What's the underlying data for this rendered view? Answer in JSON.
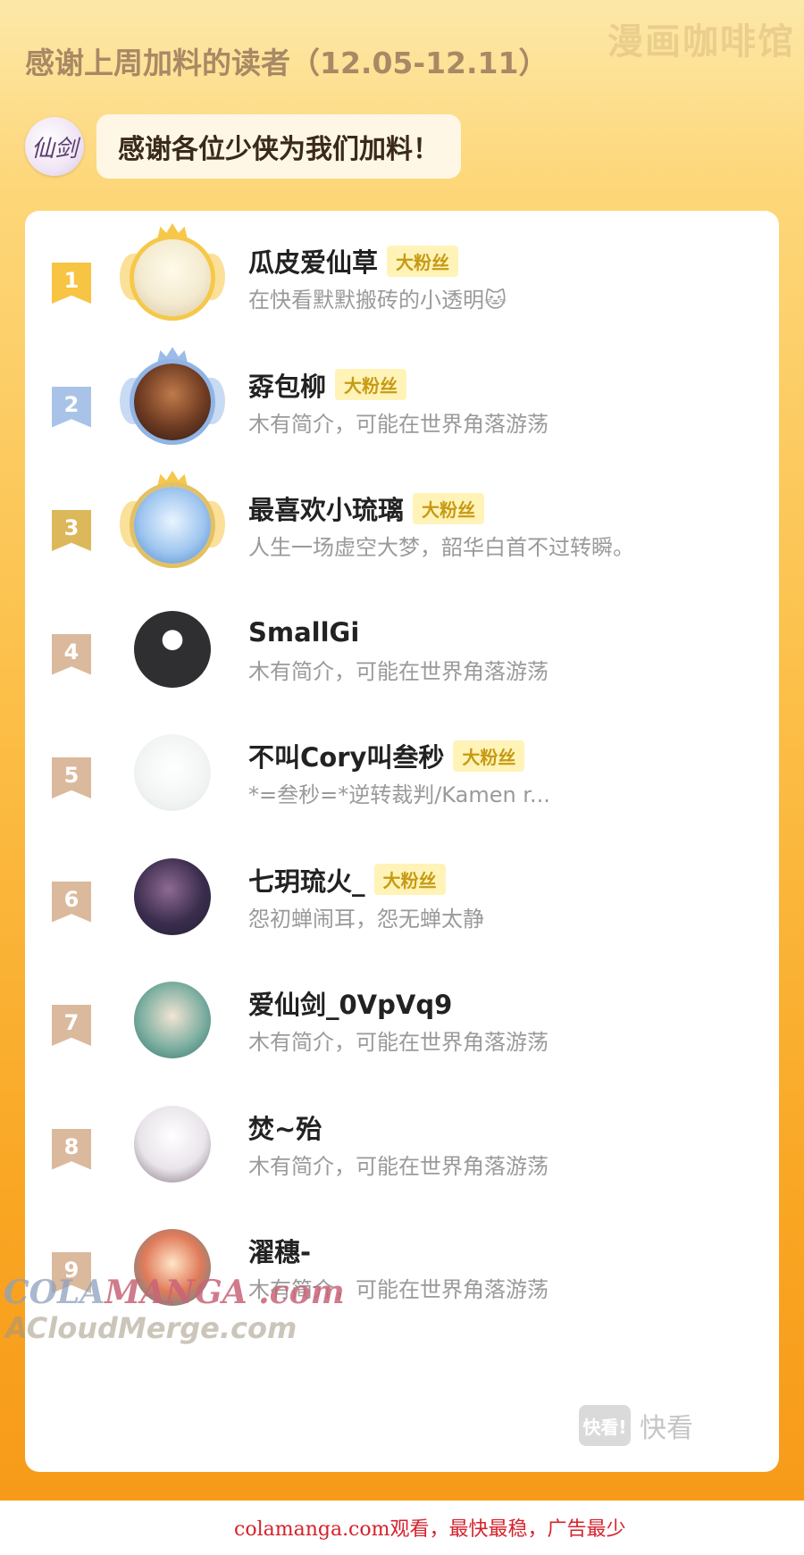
{
  "watermark_top": "漫画咖啡馆",
  "headline": "感谢上周加料的读者（12.05-12.11）",
  "logo_text": "仙剑",
  "banner_text": "感谢各位少侠为我们加料！",
  "fan_badge_label": "大粉丝",
  "readers": [
    {
      "rank": "1",
      "name": "瓜皮爱仙草",
      "bio": "在快看默默搬砖的小透明🐱",
      "fan": true,
      "tier": "gold"
    },
    {
      "rank": "2",
      "name": "孬包柳",
      "bio": "木有简介，可能在世界角落游荡",
      "fan": true,
      "tier": "silver"
    },
    {
      "rank": "3",
      "name": "最喜欢小琉璃",
      "bio": "人生一场虚空大梦，韶华白首不过转瞬。",
      "fan": true,
      "tier": "bronze"
    },
    {
      "rank": "4",
      "name": "SmallGi",
      "bio": "木有简介，可能在世界角落游荡",
      "fan": false,
      "tier": "none"
    },
    {
      "rank": "5",
      "name": "不叫Cory叫叁秒",
      "bio": "*=叁秒=*逆转裁判/Kamen r...",
      "fan": true,
      "tier": "none"
    },
    {
      "rank": "6",
      "name": "七玥琉火_",
      "bio": "怨初蝉闹耳，怨无蝉太静",
      "fan": true,
      "tier": "none"
    },
    {
      "rank": "7",
      "name": "爱仙剑_0VpVq9",
      "bio": "木有简介，可能在世界角落游荡",
      "fan": false,
      "tier": "none"
    },
    {
      "rank": "8",
      "name": "焚~殆",
      "bio": "木有简介，可能在世界角落游荡",
      "fan": false,
      "tier": "none"
    },
    {
      "rank": "9",
      "name": "濯穗-",
      "bio": "木有简介，可能在世界角落游荡",
      "fan": false,
      "tier": "none"
    }
  ],
  "watermark_colamanga_a": "COLA",
  "watermark_colamanga_b": "MANGA .com",
  "watermark_acloud": "ACloudMerge.com",
  "watermark_kuaikan_box": "快看!",
  "watermark_kuaikan_text": "快看",
  "footer_text": "colamanga.com观看，最快最稳，广告最少",
  "colors": {
    "gold": "#f7c443",
    "silver": "#a9c3e8",
    "bronze": "#dcb85a",
    "rank_default": "#dbb99c",
    "footer_red": "#d5222d"
  }
}
